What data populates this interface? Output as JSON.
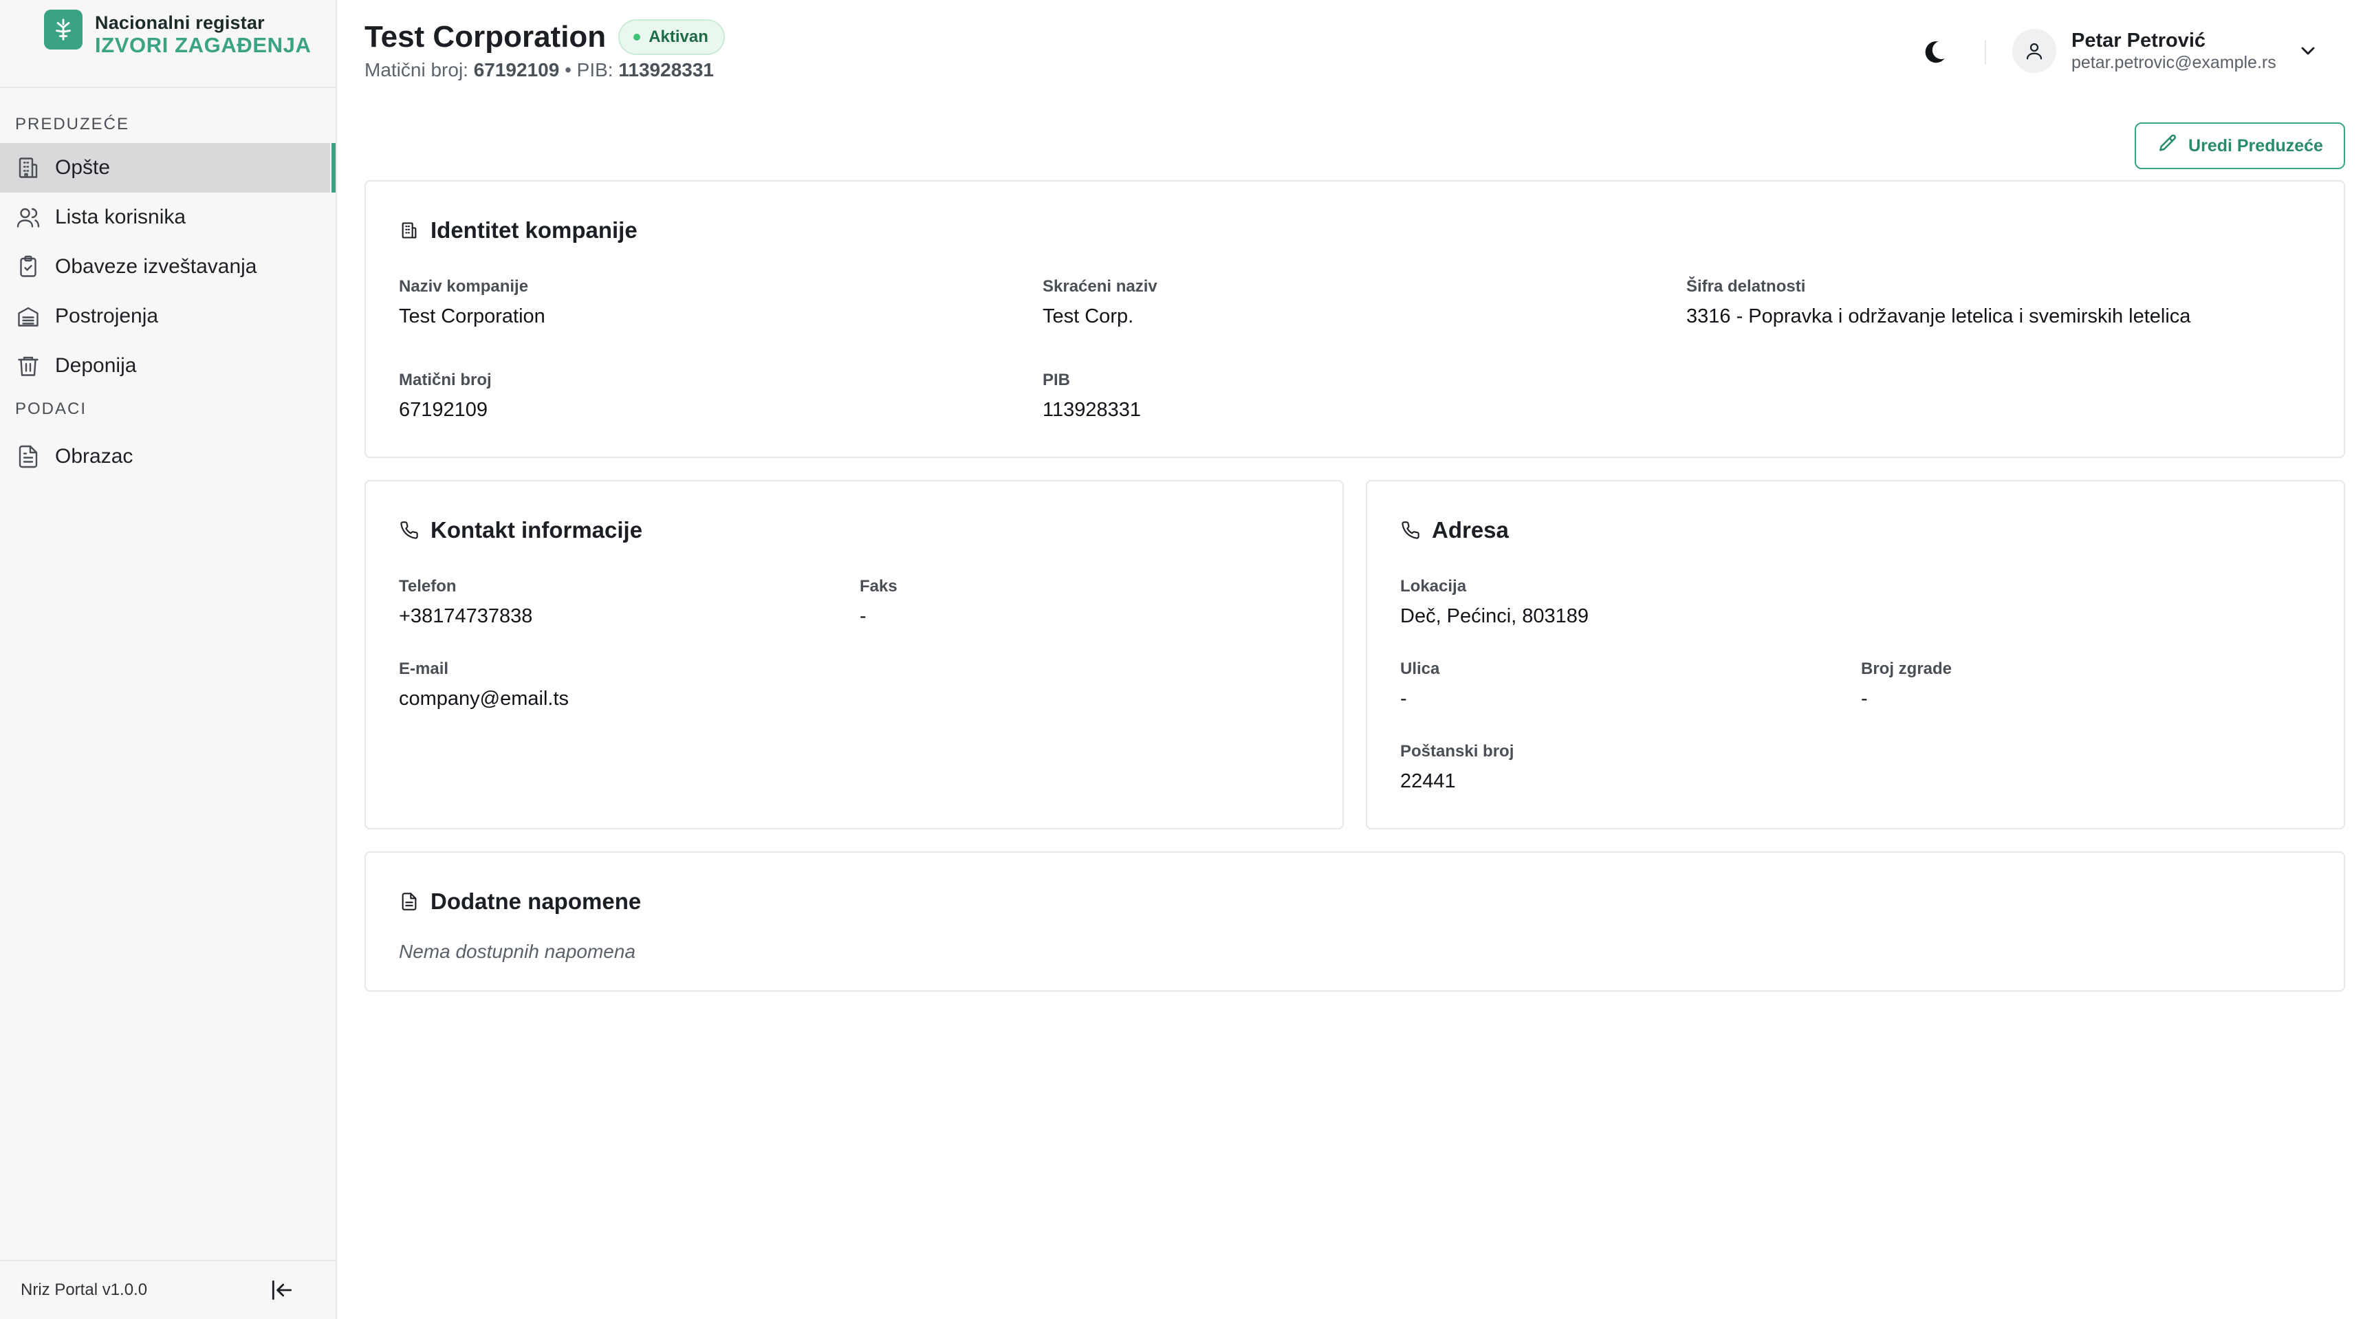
{
  "brand": {
    "top": "Nacionalni registar",
    "bottom": "IZVORI ZAGAĐENJA"
  },
  "sidebar": {
    "section_company": "PREDUZEĆE",
    "section_data": "PODACI",
    "items": [
      {
        "label": "Opšte",
        "icon": "building-icon"
      },
      {
        "label": "Lista korisnika",
        "icon": "users-icon"
      },
      {
        "label": "Obaveze izveštavanja",
        "icon": "clipboard-check-icon"
      },
      {
        "label": "Postrojenja",
        "icon": "factory-icon"
      },
      {
        "label": "Deponija",
        "icon": "trash-icon"
      },
      {
        "label": "Obrazac",
        "icon": "document-icon"
      }
    ],
    "version": "Nriz Portal v1.0.0"
  },
  "header": {
    "title": "Test Corporation",
    "status": "Aktivan",
    "mb_label": "Matični broj:",
    "mb_value": "67192109",
    "separator": "•",
    "pib_label": "PIB:",
    "pib_value": "113928331"
  },
  "user": {
    "name": "Petar Petrović",
    "email": "petar.petrovic@example.rs"
  },
  "actions": {
    "edit": "Uredi Preduzeće"
  },
  "identity": {
    "title": "Identitet kompanije",
    "name_label": "Naziv kompanije",
    "name_value": "Test Corporation",
    "short_label": "Skraćeni naziv",
    "short_value": "Test Corp.",
    "activity_label": "Šifra delatnosti",
    "activity_value": "3316 - Popravka i održavanje letelica i svemirskih letelica",
    "mb_label": "Matični broj",
    "mb_value": "67192109",
    "pib_label": "PIB",
    "pib_value": "113928331"
  },
  "contact": {
    "title": "Kontakt informacije",
    "phone_label": "Telefon",
    "phone_value": "+38174737838",
    "fax_label": "Faks",
    "fax_value": "-",
    "email_label": "E-mail",
    "email_value": "company@email.ts"
  },
  "address": {
    "title": "Adresa",
    "location_label": "Lokacija",
    "location_value": "Deč, Pećinci, 803189",
    "street_label": "Ulica",
    "street_value": "-",
    "building_label": "Broj zgrade",
    "building_value": "-",
    "postal_label": "Poštanski broj",
    "postal_value": "22441"
  },
  "notes": {
    "title": "Dodatne napomene",
    "empty": "Nema dostupnih napomena"
  },
  "colors": {
    "accent": "#3aa383",
    "active_bg": "#d9d9db",
    "badge_bg": "#eaf7ef"
  }
}
